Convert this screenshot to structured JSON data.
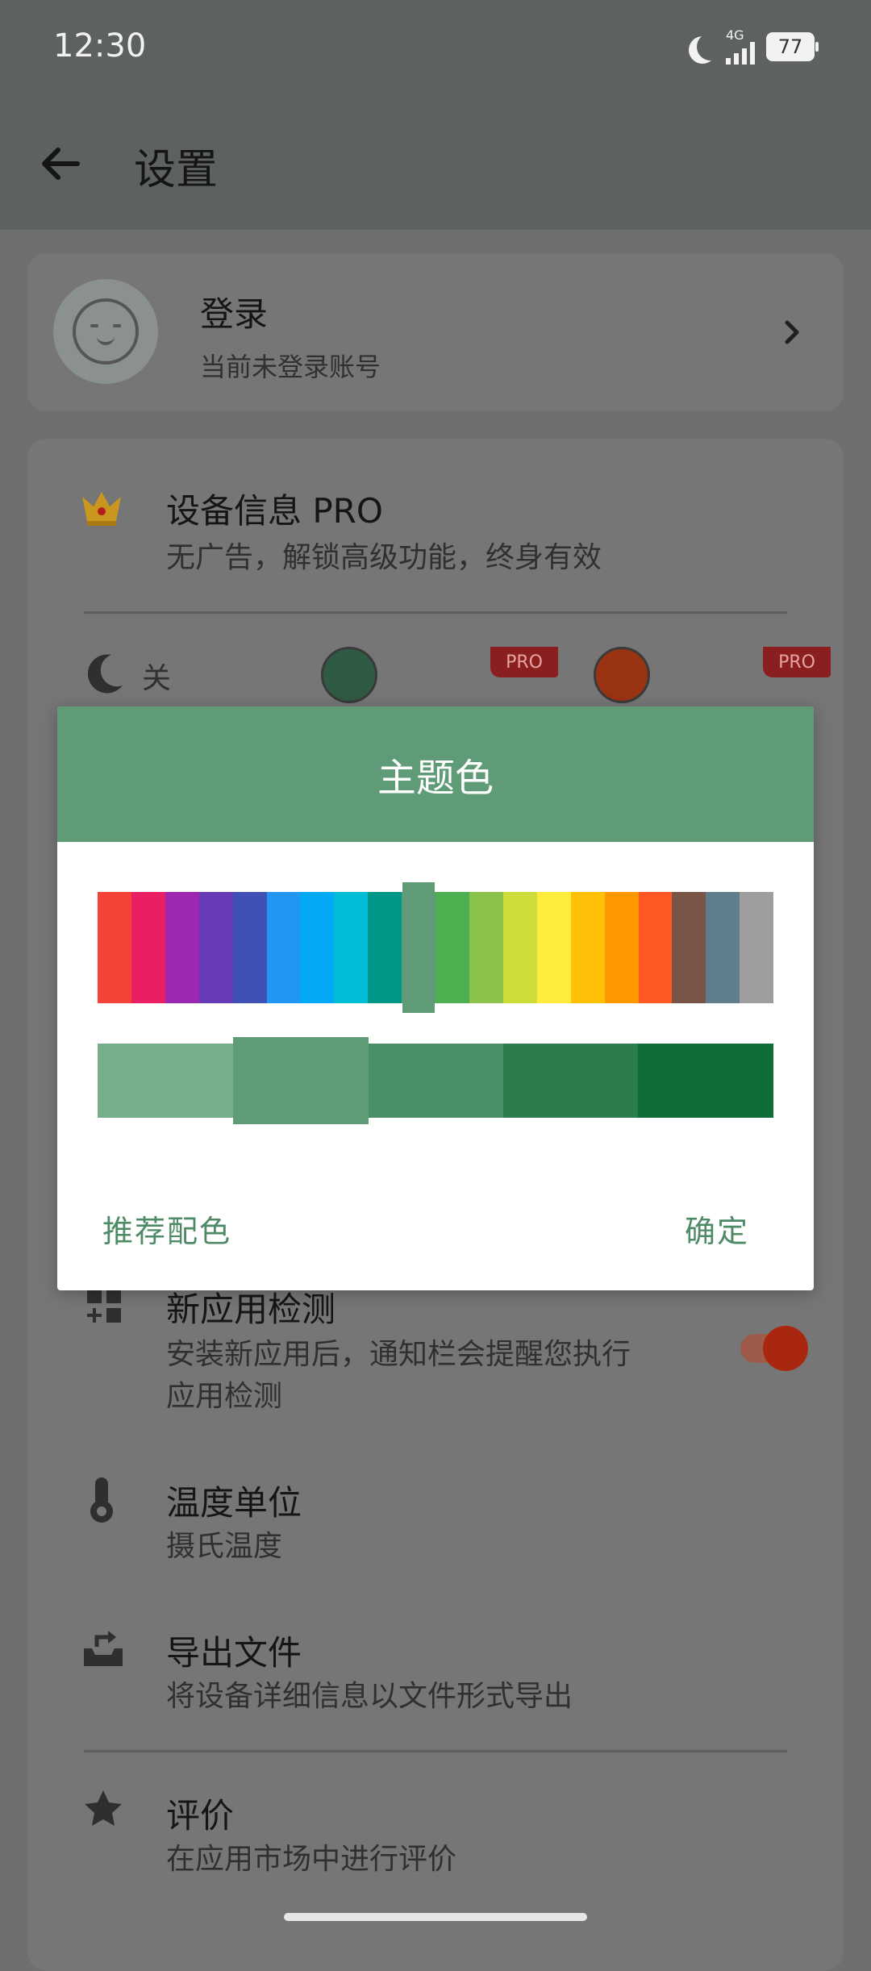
{
  "status": {
    "time": "12:30",
    "network": "4G",
    "battery": "77"
  },
  "toolbar": {
    "title": "设置"
  },
  "login": {
    "title": "登录",
    "subtitle": "当前未登录账号"
  },
  "pro": {
    "title": "设备信息 PRO",
    "subtitle": "无广告，解锁高级功能，终身有效"
  },
  "dark_mode": {
    "label": "关",
    "pro_tag": "PRO"
  },
  "theme_dots": [
    {
      "color": "#2f5a43"
    },
    {
      "color": "#9a3312"
    }
  ],
  "new_app": {
    "title": "新应用检测",
    "subtitle_line1": "安装新应用后，通知栏会提醒您执行",
    "subtitle_line2": "应用检测",
    "toggle_on": true
  },
  "temp_unit": {
    "title": "温度单位",
    "subtitle": "摄氏温度"
  },
  "export": {
    "title": "导出文件",
    "subtitle": "将设备详细信息以文件形式导出"
  },
  "rate": {
    "title": "评价",
    "subtitle": "在应用市场中进行评价"
  },
  "dialog": {
    "title": "主题色",
    "palette": [
      "#f44336",
      "#e91e63",
      "#9c27b0",
      "#673ab7",
      "#3f51b5",
      "#2196f3",
      "#03a9f4",
      "#00bcd4",
      "#009688",
      "#5f9b77",
      "#4caf50",
      "#8bc34a",
      "#cddc39",
      "#ffeb3b",
      "#ffc107",
      "#ff9800",
      "#ff5722",
      "#795548",
      "#607d8b",
      "#9e9e9e"
    ],
    "selected_palette_index": 9,
    "shades": [
      "#74ae8a",
      "#5f9b77",
      "#4a8f65",
      "#2b7d4d",
      "#0f6e37"
    ],
    "selected_shade_index": 1,
    "recommend_label": "推荐配色",
    "ok_label": "确定"
  }
}
